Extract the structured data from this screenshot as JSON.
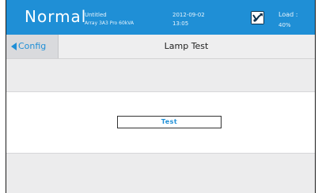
{
  "header": {
    "status": "Normal",
    "project_name": "Untitled",
    "device_model": "Array 3A3 Pro 60kVA",
    "date": "2012-09-02",
    "time": "13:05",
    "mode_icon": "bypass-mode-icon",
    "load_label": "Load :",
    "load_value": "40%",
    "background_color": "#1f8fd6"
  },
  "nav": {
    "back_label": "Config",
    "back_icon": "triangle-left-icon",
    "title": "Lamp Test"
  },
  "main": {
    "test_button_label": "Test"
  },
  "colors": {
    "accent": "#1f8fd6",
    "panel_gray": "#ececed"
  }
}
